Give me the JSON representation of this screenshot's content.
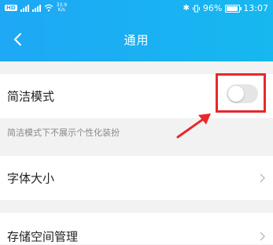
{
  "status_bar": {
    "hd_badge": "HD",
    "net_speed": "33.9",
    "net_speed_unit": "K/s",
    "battery_percent": "96%",
    "time": "13:07"
  },
  "nav": {
    "title": "通用",
    "back_icon": "chevron-left-icon"
  },
  "settings": {
    "simple_mode": {
      "label": "简洁模式",
      "toggle_on": false,
      "hint": "简洁模式下不展示个性化装扮"
    },
    "font_size": {
      "label": "字体大小"
    },
    "storage": {
      "label": "存储空间管理"
    }
  },
  "colors": {
    "header": "#1ea8f5",
    "highlight": "#e8282b",
    "toggle_off": "#e5e5e5"
  }
}
